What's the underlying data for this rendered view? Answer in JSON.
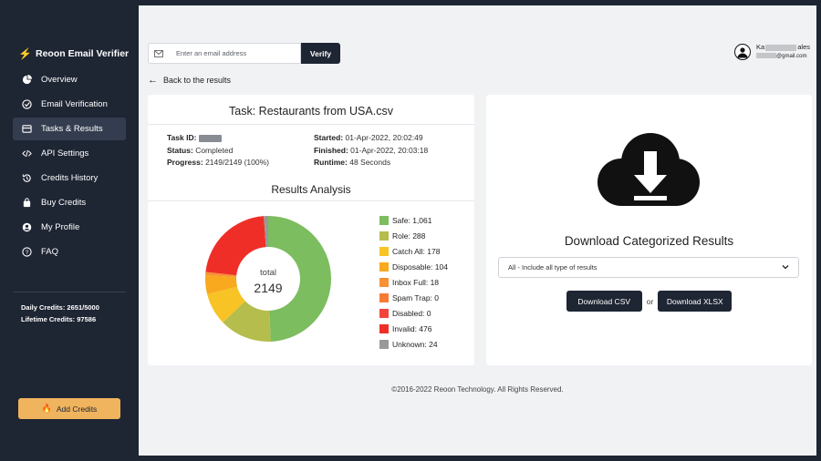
{
  "sidebar": {
    "brand": "Reoon Email Verifier",
    "items": [
      {
        "label": "Overview",
        "icon": "pie-chart-icon"
      },
      {
        "label": "Email Verification",
        "icon": "check-circle-icon"
      },
      {
        "label": "Tasks & Results",
        "icon": "list-icon",
        "active": true
      },
      {
        "label": "API Settings",
        "icon": "code-icon"
      },
      {
        "label": "Credits History",
        "icon": "history-icon"
      },
      {
        "label": "Buy Credits",
        "icon": "shopping-bag-icon"
      },
      {
        "label": "My Profile",
        "icon": "user-icon"
      },
      {
        "label": "FAQ",
        "icon": "question-icon"
      }
    ],
    "daily_credits": "Daily Credits: 2651/5000",
    "lifetime_credits": "Lifetime Credits: 97586",
    "add_credits_label": "Add Credits"
  },
  "header": {
    "email_placeholder": "Enter an email address",
    "verify_label": "Verify",
    "user_name_start": "Ka",
    "user_name_end": "ales",
    "user_email_end": "@gmail.com"
  },
  "back_label": "Back to the results",
  "task": {
    "title": "Task: Restaurants from USA.csv",
    "task_id_label": "Task ID:",
    "status_label": "Status:",
    "status_value": "Completed",
    "progress_label": "Progress:",
    "progress_value": "2149/2149 (100%)",
    "started_label": "Started:",
    "started_value": "01-Apr-2022, 20:02:49",
    "finished_label": "Finished:",
    "finished_value": "01-Apr-2022, 20:03:18",
    "runtime_label": "Runtime:",
    "runtime_value": "48 Seconds"
  },
  "analysis": {
    "title": "Results Analysis",
    "center_label": "total",
    "center_value": "2149"
  },
  "chart_data": {
    "type": "pie",
    "title": "Results Analysis",
    "total": 2149,
    "categories": [
      "Safe",
      "Role",
      "Catch All",
      "Disposable",
      "Inbox Full",
      "Spam Trap",
      "Disabled",
      "Invalid",
      "Unknown"
    ],
    "values": [
      1061,
      288,
      178,
      104,
      18,
      0,
      0,
      476,
      24
    ],
    "colors": [
      "#7cbd5f",
      "#b5bd4c",
      "#f7c325",
      "#f8a91e",
      "#f89034",
      "#f77b35",
      "#f2443a",
      "#ef2f27",
      "#999999"
    ],
    "legend_labels": [
      "Safe: 1,061",
      "Role: 288",
      "Catch All: 178",
      "Disposable: 104",
      "Inbox Full: 18",
      "Spam Trap: 0",
      "Disabled: 0",
      "Invalid: 476",
      "Unknown: 24"
    ]
  },
  "download": {
    "title": "Download Categorized Results",
    "select_value": "All - Include all type of results",
    "csv_label": "Download CSV",
    "or_label": "or",
    "xlsx_label": "Download XLSX"
  },
  "footer": "©2016-2022 Reoon Technology. All Rights Reserved."
}
